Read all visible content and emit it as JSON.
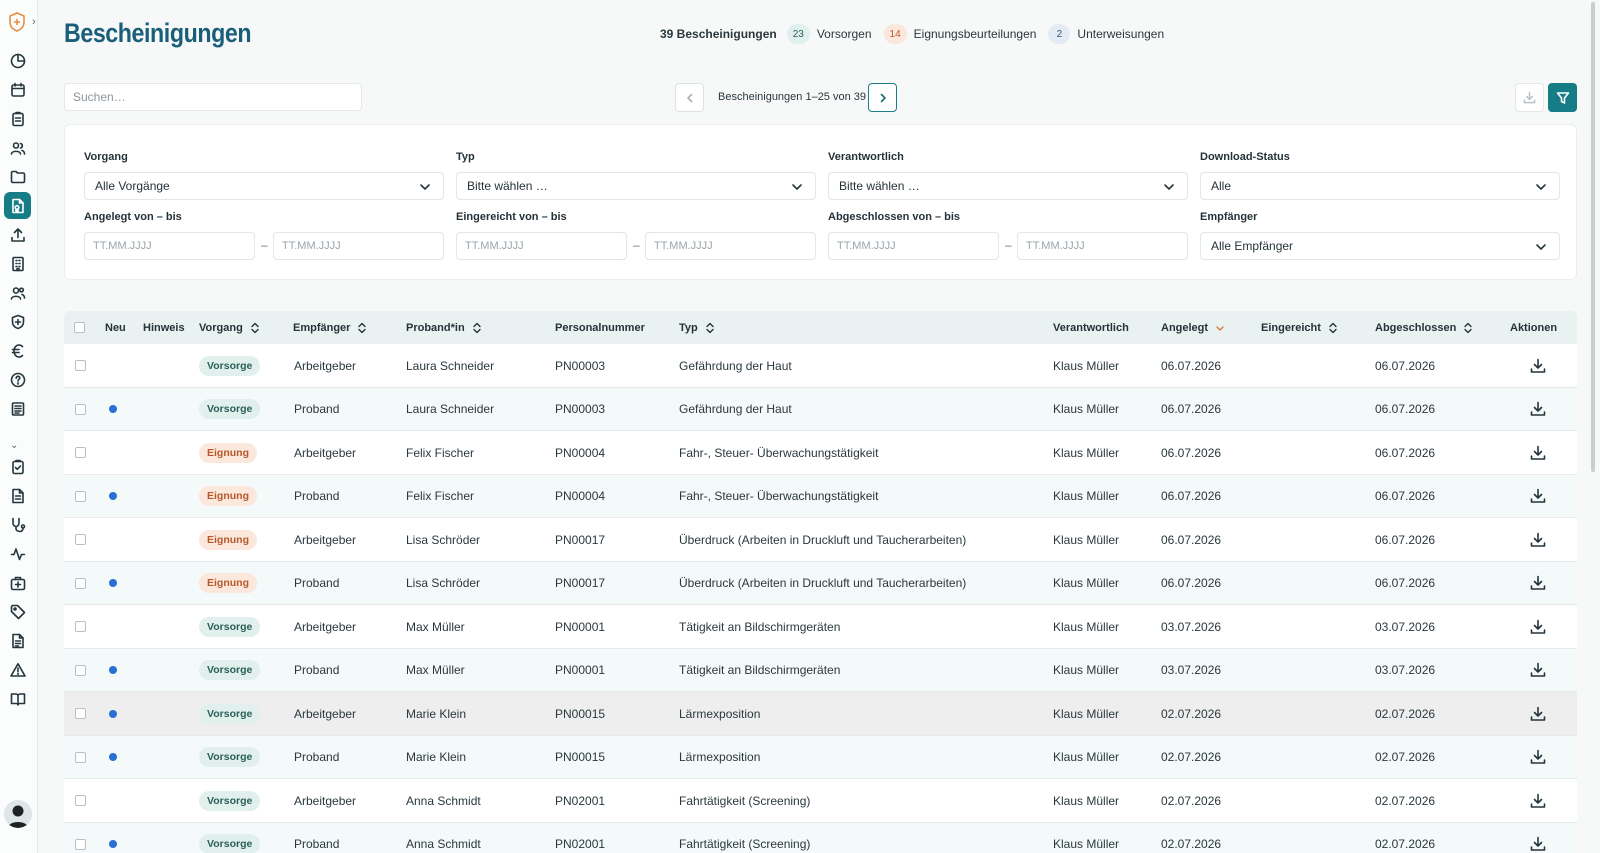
{
  "header": {
    "title": "Bescheinigungen",
    "summary": {
      "total_label": "39 Bescheinigungen",
      "vorsorgen_count": "23",
      "vorsorgen_label": "Vorsorgen",
      "eignung_count": "14",
      "eignung_label": "Eignungsbeurteilungen",
      "unterweisungen_count": "2",
      "unterweisungen_label": "Unterweisungen"
    }
  },
  "toolbar": {
    "search_placeholder": "Suchen…",
    "pager_text": "Bescheinigungen 1–25 von 39"
  },
  "filters": {
    "vorgang": {
      "label": "Vorgang",
      "value": "Alle Vorgänge"
    },
    "typ": {
      "label": "Typ",
      "value": "Bitte wählen …"
    },
    "verantwortlich": {
      "label": "Verantwortlich",
      "value": "Bitte wählen …"
    },
    "download_status": {
      "label": "Download-Status",
      "value": "Alle"
    },
    "angelegt": {
      "label": "Angelegt von – bis",
      "from_placeholder": "TT.MM.JJJJ",
      "to_placeholder": "TT.MM.JJJJ"
    },
    "eingereicht": {
      "label": "Eingereicht von – bis",
      "from_placeholder": "TT.MM.JJJJ",
      "to_placeholder": "TT.MM.JJJJ"
    },
    "abgeschlossen": {
      "label": "Abgeschlossen von – bis",
      "from_placeholder": "TT.MM.JJJJ",
      "to_placeholder": "TT.MM.JJJJ"
    },
    "empfaenger": {
      "label": "Empfänger",
      "value": "Alle Empfänger"
    },
    "dash": "–"
  },
  "table": {
    "columns": {
      "neu": "Neu",
      "hinweis": "Hinweis",
      "vorgang": "Vorgang",
      "empfaenger": "Empfänger",
      "proband": "Proband*in",
      "personalnummer": "Personalnummer",
      "typ": "Typ",
      "verantwortlich": "Verantwortlich",
      "angelegt": "Angelegt",
      "eingereicht": "Eingereicht",
      "abgeschlossen": "Abgeschlossen",
      "aktionen": "Aktionen"
    },
    "sorted_column": "angelegt",
    "rows": [
      {
        "neu": false,
        "vorgang": "Vorsorge",
        "vorgang_kind": "vorsorge",
        "empfaenger": "Arbeitgeber",
        "proband": "Laura Schneider",
        "personalnummer": "PN00003",
        "typ": "Gefährdung der Haut",
        "verantwortlich": "Klaus Müller",
        "angelegt": "06.07.2026",
        "eingereicht": "",
        "abgeschlossen": "06.07.2026"
      },
      {
        "neu": true,
        "vorgang": "Vorsorge",
        "vorgang_kind": "vorsorge",
        "empfaenger": "Proband",
        "proband": "Laura Schneider",
        "personalnummer": "PN00003",
        "typ": "Gefährdung der Haut",
        "verantwortlich": "Klaus Müller",
        "angelegt": "06.07.2026",
        "eingereicht": "",
        "abgeschlossen": "06.07.2026"
      },
      {
        "neu": false,
        "vorgang": "Eignung",
        "vorgang_kind": "eignung",
        "empfaenger": "Arbeitgeber",
        "proband": "Felix Fischer",
        "personalnummer": "PN00004",
        "typ": "Fahr-, Steuer- Überwachungstätigkeit",
        "verantwortlich": "Klaus Müller",
        "angelegt": "06.07.2026",
        "eingereicht": "",
        "abgeschlossen": "06.07.2026"
      },
      {
        "neu": true,
        "vorgang": "Eignung",
        "vorgang_kind": "eignung",
        "empfaenger": "Proband",
        "proband": "Felix Fischer",
        "personalnummer": "PN00004",
        "typ": "Fahr-, Steuer- Überwachungstätigkeit",
        "verantwortlich": "Klaus Müller",
        "angelegt": "06.07.2026",
        "eingereicht": "",
        "abgeschlossen": "06.07.2026"
      },
      {
        "neu": false,
        "vorgang": "Eignung",
        "vorgang_kind": "eignung",
        "empfaenger": "Arbeitgeber",
        "proband": "Lisa Schröder",
        "personalnummer": "PN00017",
        "typ": "Überdruck (Arbeiten in Druckluft und Taucherarbeiten)",
        "verantwortlich": "Klaus Müller",
        "angelegt": "06.07.2026",
        "eingereicht": "",
        "abgeschlossen": "06.07.2026"
      },
      {
        "neu": true,
        "vorgang": "Eignung",
        "vorgang_kind": "eignung",
        "empfaenger": "Proband",
        "proband": "Lisa Schröder",
        "personalnummer": "PN00017",
        "typ": "Überdruck (Arbeiten in Druckluft und Taucherarbeiten)",
        "verantwortlich": "Klaus Müller",
        "angelegt": "06.07.2026",
        "eingereicht": "",
        "abgeschlossen": "06.07.2026"
      },
      {
        "neu": false,
        "vorgang": "Vorsorge",
        "vorgang_kind": "vorsorge",
        "empfaenger": "Arbeitgeber",
        "proband": "Max Müller",
        "personalnummer": "PN00001",
        "typ": "Tätigkeit an Bildschirmgeräten",
        "verantwortlich": "Klaus Müller",
        "angelegt": "03.07.2026",
        "eingereicht": "",
        "abgeschlossen": "03.07.2026"
      },
      {
        "neu": true,
        "vorgang": "Vorsorge",
        "vorgang_kind": "vorsorge",
        "empfaenger": "Proband",
        "proband": "Max Müller",
        "personalnummer": "PN00001",
        "typ": "Tätigkeit an Bildschirmgeräten",
        "verantwortlich": "Klaus Müller",
        "angelegt": "03.07.2026",
        "eingereicht": "",
        "abgeschlossen": "03.07.2026"
      },
      {
        "neu": true,
        "vorgang": "Vorsorge",
        "vorgang_kind": "vorsorge",
        "empfaenger": "Arbeitgeber",
        "proband": "Marie Klein",
        "personalnummer": "PN00015",
        "typ": "Lärmexposition",
        "verantwortlich": "Klaus Müller",
        "angelegt": "02.07.2026",
        "eingereicht": "",
        "abgeschlossen": "02.07.2026"
      },
      {
        "neu": true,
        "vorgang": "Vorsorge",
        "vorgang_kind": "vorsorge",
        "empfaenger": "Proband",
        "proband": "Marie Klein",
        "personalnummer": "PN00015",
        "typ": "Lärmexposition",
        "verantwortlich": "Klaus Müller",
        "angelegt": "02.07.2026",
        "eingereicht": "",
        "abgeschlossen": "02.07.2026"
      },
      {
        "neu": false,
        "vorgang": "Vorsorge",
        "vorgang_kind": "vorsorge",
        "empfaenger": "Arbeitgeber",
        "proband": "Anna Schmidt",
        "personalnummer": "PN02001",
        "typ": "Fahrtätigkeit (Screening)",
        "verantwortlich": "Klaus Müller",
        "angelegt": "02.07.2026",
        "eingereicht": "",
        "abgeschlossen": "02.07.2026"
      },
      {
        "neu": true,
        "vorgang": "Vorsorge",
        "vorgang_kind": "vorsorge",
        "empfaenger": "Proband",
        "proband": "Anna Schmidt",
        "personalnummer": "PN02001",
        "typ": "Fahrtätigkeit (Screening)",
        "verantwortlich": "Klaus Müller",
        "angelegt": "02.07.2026",
        "eingereicht": "",
        "abgeschlossen": "02.07.2026"
      }
    ]
  },
  "sidebar": {
    "active_item": "bescheinigungen",
    "items_top": [
      "dashboard-icon",
      "calendar-icon",
      "clipboard-icon",
      "users-icon",
      "folder-icon",
      "certificate-icon",
      "upload-icon",
      "building-icon",
      "team-icon",
      "shield-icon",
      "euro-icon",
      "help-icon",
      "news-icon"
    ],
    "items_bottom": [
      "checklist-icon",
      "document-icon",
      "stethoscope-icon",
      "activity-icon",
      "first-aid-icon",
      "tag-icon",
      "report-icon",
      "warning-icon",
      "book-icon"
    ]
  },
  "colors": {
    "accent": "#167c86",
    "title": "#1a5f7a",
    "vorsorge_bg": "#e1f0ed",
    "eignung_bg": "#fbe7dc",
    "new_dot": "#2a6fd3"
  }
}
